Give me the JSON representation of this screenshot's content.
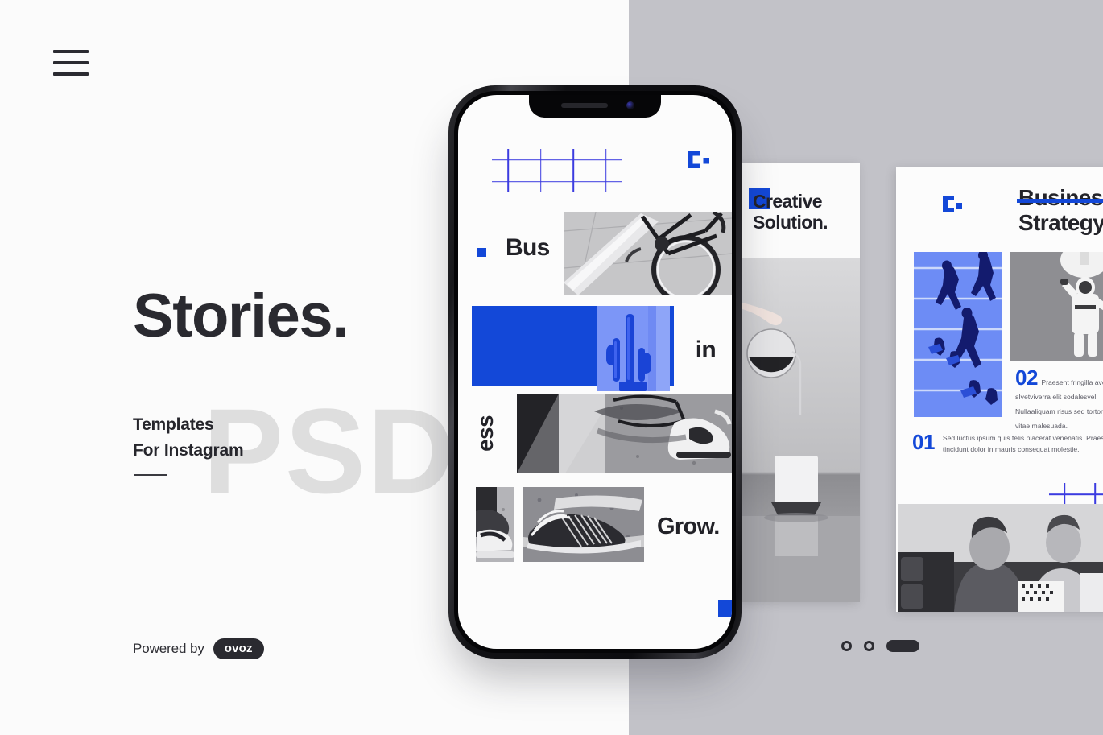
{
  "meta": {
    "accent_blue": "#1348D8",
    "dark": "#2A2A30",
    "bg_left": "#FBFBFB",
    "bg_right": "#C2C2C8"
  },
  "nav": {
    "menu_icon": "hamburger-menu-icon"
  },
  "hero": {
    "headline": "Stories.",
    "watermark": "PSD",
    "sub_line_1": "Templates",
    "sub_line_2": "For Instagram"
  },
  "footer": {
    "powered_label": "Powered by",
    "brand": "ovoz"
  },
  "phone": {
    "logo_icon": "brand-c-logo-icon",
    "marker_icon": "blue-square-marker",
    "word_1": "Bus",
    "word_2": "in",
    "word_3": "ess",
    "word_4": "Grow.",
    "images": [
      {
        "name": "bicycle-photo",
        "alt": "bicycle wheel and frame, grayscale"
      },
      {
        "name": "cactus-photo",
        "alt": "cactus in blue duotone"
      },
      {
        "name": "sneakers-skateboard-photo",
        "alt": "sneakers on skateboard, grayscale"
      },
      {
        "name": "sneaker-closeup-photo",
        "alt": "sneaker on pavement, grayscale"
      },
      {
        "name": "sneaker-striped-photo",
        "alt": "striped sneaker on asphalt, grayscale"
      }
    ]
  },
  "card_creative": {
    "title_line_1": "Creative",
    "title_line_2": "Solution.",
    "image_alt": "hand pouring carafe into cup, grayscale"
  },
  "card_business": {
    "logo_icon": "brand-c-logo-icon",
    "title_line_1": "Business",
    "title_line_2": "Strategy.",
    "image_runners_alt": "runners on track, blue duotone",
    "image_figure_alt": "figure under pendant lamp, grayscale",
    "image_people_alt": "two business people smiling at laptop, grayscale",
    "blocks": [
      {
        "number": "02",
        "text": "Praesent fringilla avelit lectus, sIvetviverra elit sodalesvel. Nullaaliquam risus sed tortor lobortis, vitae malesuada."
      },
      {
        "number": "01",
        "text": "Sed luctus ipsum quis felis placerat venenatis. Praesent tincidunt dolor in mauris consequat molestie."
      }
    ]
  },
  "pagination": {
    "items": [
      "dot",
      "dot",
      "active-pill"
    ]
  }
}
